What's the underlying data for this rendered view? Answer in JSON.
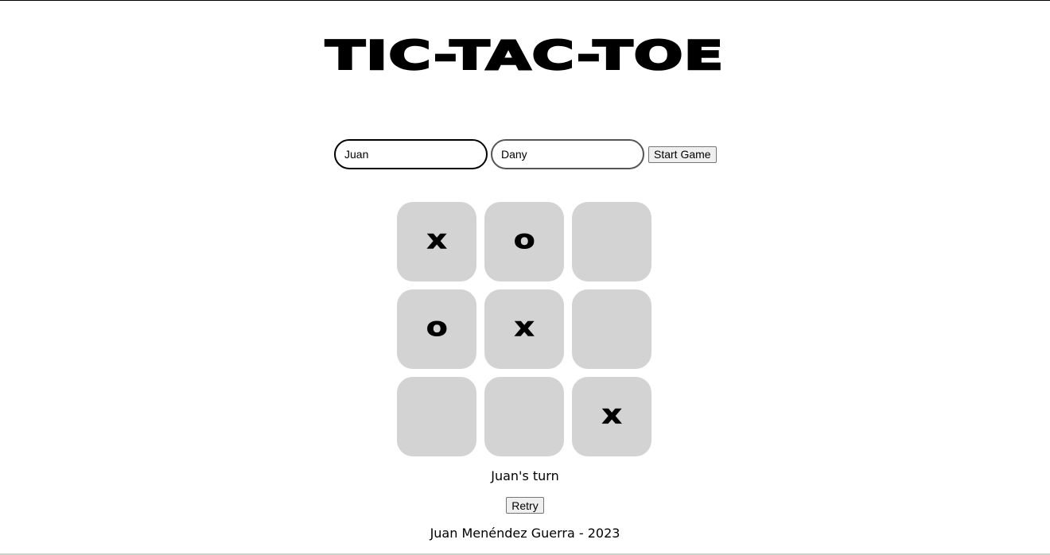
{
  "title": "TIC-TAC-TOE",
  "players": {
    "player1_value": "Juan",
    "player2_value": "Dany",
    "start_label": "Start Game"
  },
  "board": {
    "cells": [
      "X",
      "O",
      "",
      "O",
      "X",
      "",
      "",
      "",
      "X"
    ]
  },
  "status": "Juan's turn",
  "retry_label": "Retry",
  "footer": "Juan Menéndez Guerra - 2023",
  "colors": {
    "cell_background": "#d3d3d3",
    "page_background": "#ffffff",
    "text": "#000000"
  }
}
